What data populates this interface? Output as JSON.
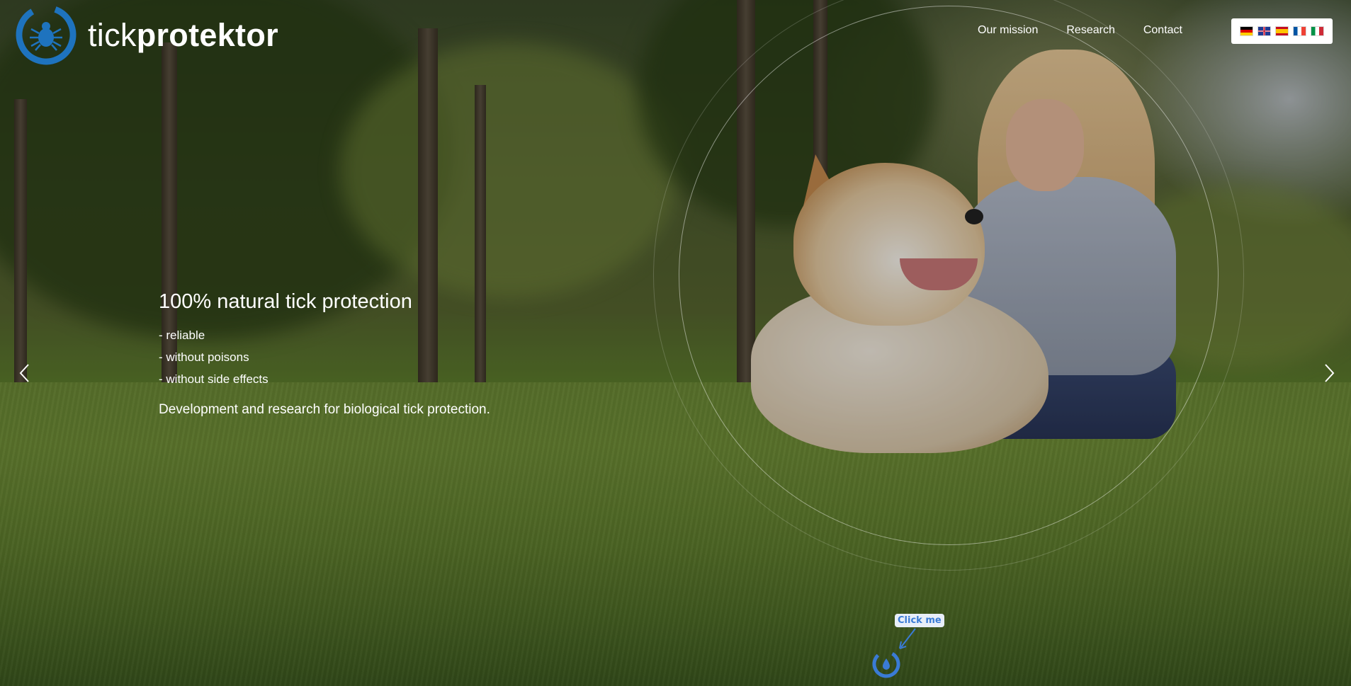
{
  "header": {
    "brand_light": "tick",
    "brand_bold": "protektor",
    "nav": [
      {
        "label": "Our mission"
      },
      {
        "label": "Research"
      },
      {
        "label": "Contact"
      }
    ],
    "languages": [
      "de",
      "gb",
      "es",
      "fr",
      "it"
    ]
  },
  "hero": {
    "title": "100% natural tick protection",
    "bullets": [
      "- reliable",
      "- without poisons",
      "- without side effects"
    ],
    "subtitle": "Development and research for biological tick protection."
  },
  "widget": {
    "badge": "Click me"
  },
  "colors": {
    "brand_blue": "#1e73be",
    "widget_blue": "#3a7bd5",
    "text": "#ffffff"
  },
  "icons": {
    "logo": "tick-in-circle-icon",
    "prev": "chevron-left-icon",
    "next": "chevron-right-icon",
    "widget": "water-drop-icon"
  }
}
